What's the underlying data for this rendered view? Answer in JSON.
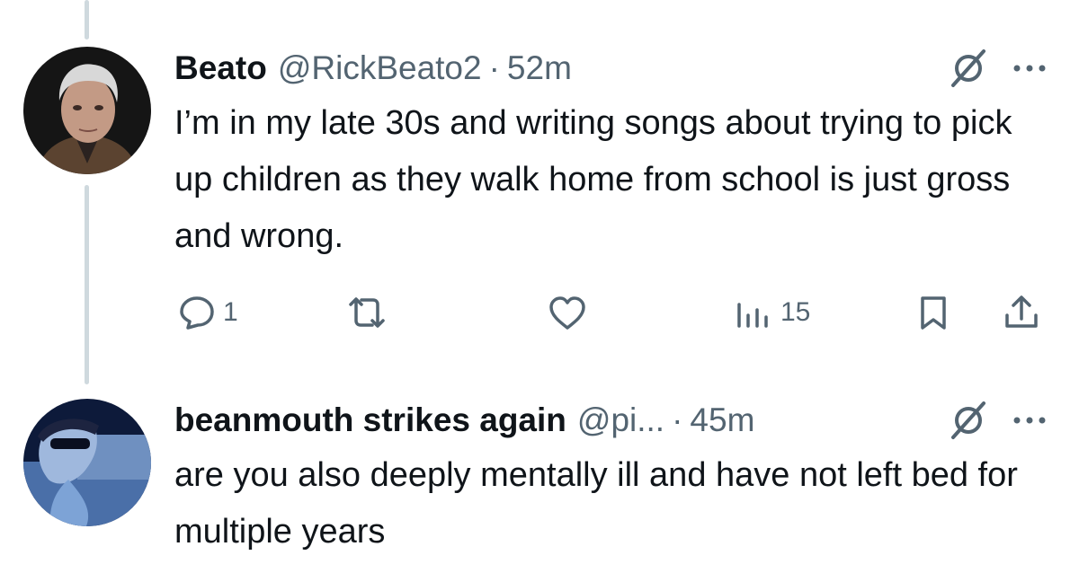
{
  "tweets": [
    {
      "name": "Beato",
      "handle": "@RickBeato2",
      "separator": "·",
      "time": "52m",
      "text": "I’m in my late 30s and writing songs about trying to pick up children as they walk home from school is just gross and wrong.",
      "actions": {
        "replies": "1",
        "reposts": "",
        "likes": "",
        "views": "15"
      }
    },
    {
      "name": "beanmouth strikes again",
      "handle": "@pi...",
      "separator": "·",
      "time": "45m",
      "text": "are you also deeply mentally ill and have not left bed for multiple years"
    }
  ],
  "icons": {
    "grok": "grok-icon",
    "more": "more-icon",
    "reply": "reply-icon",
    "repost": "repost-icon",
    "like": "like-icon",
    "views": "views-icon",
    "bookmark": "bookmark-icon",
    "share": "share-icon"
  },
  "colors": {
    "text": "#0f1419",
    "secondary": "#536471",
    "thread_line": "#cfd9de"
  }
}
